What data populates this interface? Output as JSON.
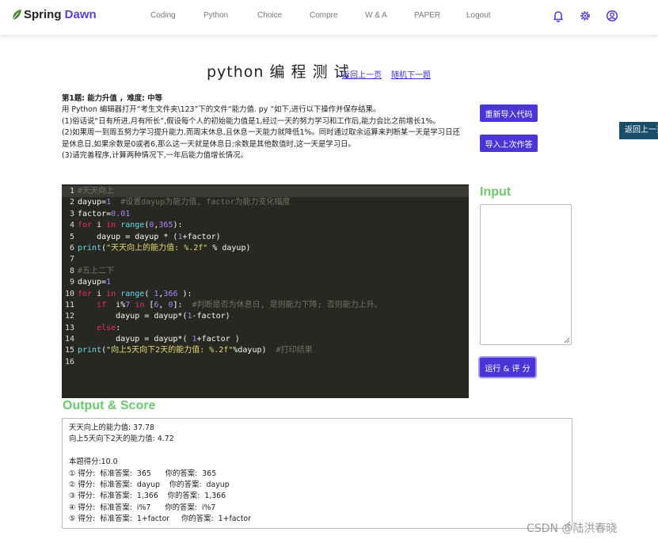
{
  "navbar": {
    "brand_spring": "Spring",
    "brand_dawn": "Dawn",
    "items": [
      "Coding",
      "Python",
      "Choice",
      "Compre",
      "W & A",
      "PAPER",
      "Logout"
    ]
  },
  "page": {
    "title": "python 编 程 测 试",
    "prev_link": "返回上一页",
    "random_link": "随机下一题"
  },
  "problem": {
    "heading": "第1题:  能力升值 ，难度:  中等",
    "lines": [
      "用 Python 编辑器打开“考生文件夹\\123”下的文件“能力值. py ”如下,进行以下操作并保存结果。",
      "(1)俗话说“日有所进,月有所长”,假设每个人的初始能力值是1,经过一天的努力学习和工作后,能力会比之前增长1%。",
      "(2)如果周一到周五努力学习提升能力,而周末休息,且休息一天能力就降低1%。同时通过取余运算来判断某一天是学习日还",
      "是休息日,如果余数是0或者6,那么这一天就是休息日;余数是其他数值时,这一天是学习日。",
      "(3)请完善程序,计算两种情况下,一年后能力值增长情况。"
    ]
  },
  "buttons": {
    "reload_code": "重新导入代码",
    "import_last": "导入上次作答",
    "run_score": "运行 & 评 分",
    "side_back": "返回上一页"
  },
  "editor": {
    "line_numbers": [
      "1",
      "2",
      "3",
      "4",
      "5",
      "6",
      "7",
      "8",
      "9",
      "10",
      "11",
      "12",
      "13",
      "14",
      "15",
      "16"
    ]
  },
  "input": {
    "label": "Input",
    "value": ""
  },
  "output": {
    "label": "Output & Score",
    "lines": [
      "天天向上的能力值: 37.78",
      "向上5天向下2天的能力值: 4.72",
      "",
      "本题得分:10.0",
      "① 得分:  标准答案:  365      你的答案:  365",
      "② 得分:  标准答案:  dayup    你的答案:  dayup",
      "③ 得分:  标准答案:  1,366    你的答案:  1,366",
      "④ 得分:  标准答案:  i%7      你的答案:  i%7",
      "⑤ 得分:  标准答案:  1+factor     你的答案:  1+factor"
    ]
  },
  "watermark": "CSDN @陆洪春晓",
  "colors": {
    "accent": "#4a36d8",
    "section_green": "#6cc96c",
    "editor_bg": "#272822"
  }
}
